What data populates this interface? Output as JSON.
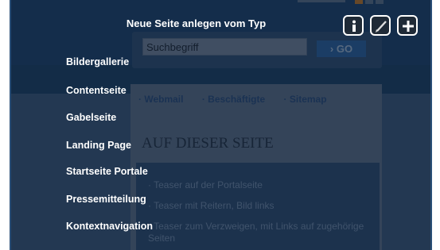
{
  "site": {
    "search_placeholder": "Suchbegriff",
    "go_label": "GO",
    "links": [
      "Webmail",
      "Beschäftigte",
      "Sitemap"
    ],
    "section_title": "AUF DIESER SEITE",
    "teasers": [
      "Teaser auf der Portalseite",
      "Teaser mit Reitern, Bild links",
      "Teaser zum Verzweigen, mit Links auf zugehörige Seiten"
    ]
  },
  "overlay": {
    "title": "Neue Seite anlegen vom Typ",
    "items": [
      {
        "label": "Bildergallerie"
      },
      {
        "label": "Contentseite"
      },
      {
        "label": "Gabelseite"
      },
      {
        "label": "Landing Page"
      },
      {
        "label": "Startseite Portale"
      },
      {
        "label": "Pressemitteilung"
      },
      {
        "label": "Kontextnavigation"
      }
    ],
    "tools": [
      "info-icon",
      "edit-pencil-icon",
      "add-plus-icon"
    ]
  }
}
